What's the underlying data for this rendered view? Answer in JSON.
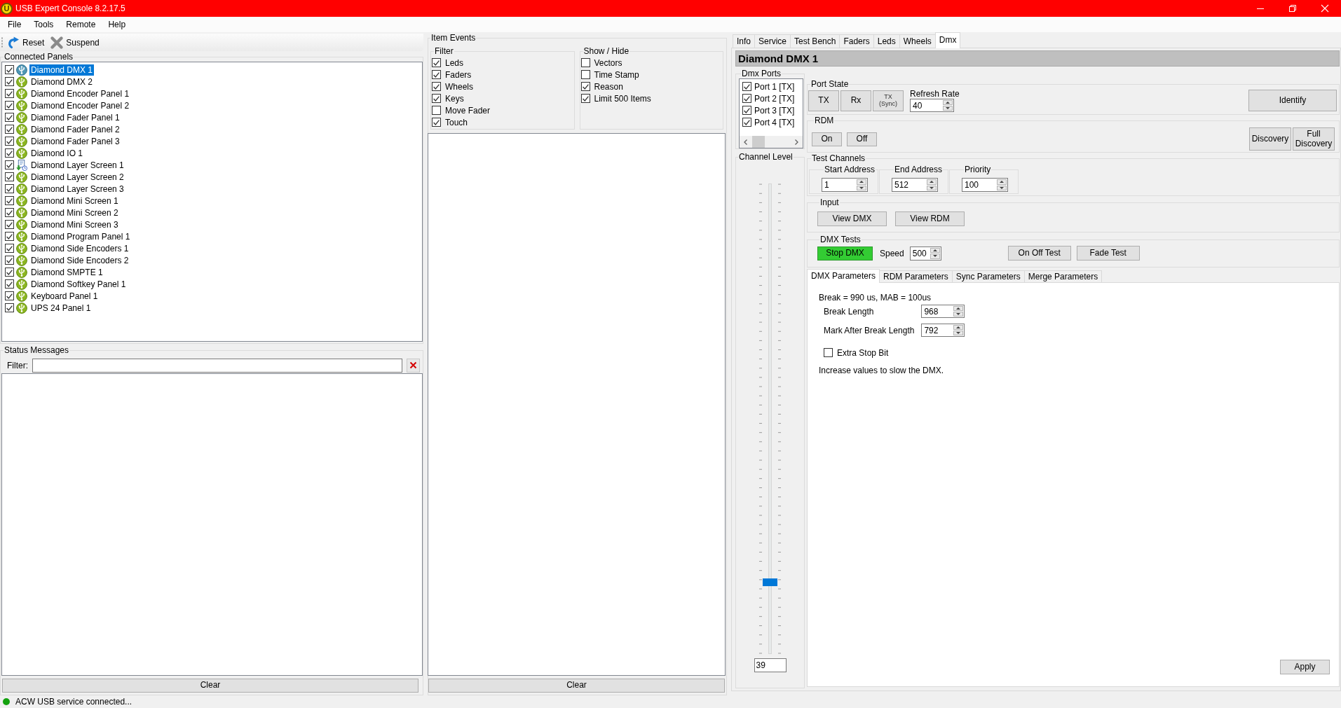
{
  "window": {
    "title": "USB Expert Console 8.2.17.5",
    "logo": "U"
  },
  "menu": [
    "File",
    "Tools",
    "Remote",
    "Help"
  ],
  "toolbar": [
    {
      "label": "Reset",
      "kind": "reset"
    },
    {
      "label": "Suspend",
      "kind": "suspend"
    }
  ],
  "connected_panels": {
    "title": "Connected Panels",
    "items": [
      {
        "label": "Diamond DMX 1",
        "kind": "usb",
        "checked": true,
        "selected": true
      },
      {
        "label": "Diamond DMX 2",
        "kind": "usb",
        "checked": true,
        "selected": false
      },
      {
        "label": "Diamond Encoder Panel 1",
        "kind": "usb",
        "checked": true,
        "selected": false
      },
      {
        "label": "Diamond Encoder Panel 2",
        "kind": "usb",
        "checked": true,
        "selected": false
      },
      {
        "label": "Diamond Fader Panel 1",
        "kind": "usb",
        "checked": true,
        "selected": false
      },
      {
        "label": "Diamond Fader Panel 2",
        "kind": "usb",
        "checked": true,
        "selected": false
      },
      {
        "label": "Diamond Fader Panel 3",
        "kind": "usb",
        "checked": true,
        "selected": false
      },
      {
        "label": "Diamond IO 1",
        "kind": "usb",
        "checked": true,
        "selected": false
      },
      {
        "label": "Diamond Layer Screen 1",
        "kind": "update",
        "checked": true,
        "selected": false
      },
      {
        "label": "Diamond Layer Screen 2",
        "kind": "usb",
        "checked": true,
        "selected": false
      },
      {
        "label": "Diamond Layer Screen 3",
        "kind": "usb",
        "checked": true,
        "selected": false
      },
      {
        "label": "Diamond Mini Screen 1",
        "kind": "usb",
        "checked": true,
        "selected": false
      },
      {
        "label": "Diamond Mini Screen 2",
        "kind": "usb",
        "checked": true,
        "selected": false
      },
      {
        "label": "Diamond Mini Screen 3",
        "kind": "usb",
        "checked": true,
        "selected": false
      },
      {
        "label": "Diamond Program Panel 1",
        "kind": "usb",
        "checked": true,
        "selected": false
      },
      {
        "label": "Diamond Side Encoders 1",
        "kind": "usb",
        "checked": true,
        "selected": false
      },
      {
        "label": "Diamond Side Encoders 2",
        "kind": "usb",
        "checked": true,
        "selected": false
      },
      {
        "label": "Diamond SMPTE 1",
        "kind": "usb",
        "checked": true,
        "selected": false
      },
      {
        "label": "Diamond Softkey Panel 1",
        "kind": "usb",
        "checked": true,
        "selected": false
      },
      {
        "label": "Keyboard Panel 1",
        "kind": "usb",
        "checked": true,
        "selected": false
      },
      {
        "label": "UPS 24 Panel 1",
        "kind": "usb",
        "checked": true,
        "selected": false
      }
    ]
  },
  "status_messages": {
    "title": "Status Messages",
    "filter_label": "Filter:",
    "clear_button": "Clear"
  },
  "item_events": {
    "title": "Item Events",
    "filter": {
      "title": "Filter",
      "items": [
        {
          "label": "Leds",
          "checked": true
        },
        {
          "label": "Faders",
          "checked": true
        },
        {
          "label": "Wheels",
          "checked": true
        },
        {
          "label": "Keys",
          "checked": true
        },
        {
          "label": "Move Fader",
          "checked": false
        },
        {
          "label": "Touch",
          "checked": true
        }
      ]
    },
    "show_hide": {
      "title": "Show / Hide",
      "items": [
        {
          "label": "Vectors",
          "checked": false
        },
        {
          "label": "Time Stamp",
          "checked": false
        },
        {
          "label": "Reason",
          "checked": true
        },
        {
          "label": "Limit 500 Items",
          "checked": true
        }
      ]
    },
    "clear_button": "Clear"
  },
  "tabs": [
    {
      "label": "Info",
      "selected": false
    },
    {
      "label": "Service",
      "selected": false
    },
    {
      "label": "Test Bench",
      "selected": false
    },
    {
      "label": "Faders",
      "selected": false
    },
    {
      "label": "Leds",
      "selected": false
    },
    {
      "label": "Wheels",
      "selected": false
    },
    {
      "label": "Dmx",
      "selected": true
    }
  ],
  "device": {
    "name": "Diamond DMX 1"
  },
  "dmx_ports": {
    "title": "Dmx Ports",
    "items": [
      {
        "label": "Port 1 [TX]",
        "checked": true
      },
      {
        "label": "Port 2 [TX]",
        "checked": true
      },
      {
        "label": "Port 3 [TX]",
        "checked": true
      },
      {
        "label": "Port 4 [TX]",
        "checked": true
      }
    ]
  },
  "channel_level": {
    "title": "Channel Level",
    "level": 0.153,
    "value": "39"
  },
  "port_state": {
    "title": "Port State",
    "buttons": [
      {
        "label": "TX"
      },
      {
        "label": "Rx"
      },
      {
        "label": "TX",
        "sublabel": "(Sync)"
      }
    ],
    "refresh_rate": {
      "label": "Refresh Rate",
      "value": "40"
    },
    "identify_button": "Identify"
  },
  "rdm": {
    "title": "RDM",
    "buttons": [
      "On",
      "Off"
    ],
    "discovery_buttons": [
      "Discovery",
      "Full Discovery"
    ]
  },
  "test_channels": {
    "title": "Test Channels",
    "fields": [
      {
        "label": "Start Address",
        "value": "1"
      },
      {
        "label": "End Address",
        "value": "512"
      },
      {
        "label": "Priority",
        "value": "100"
      }
    ]
  },
  "input": {
    "title": "Input",
    "buttons": [
      "View DMX",
      "View RDM"
    ]
  },
  "dmx_tests": {
    "title": "DMX Tests",
    "stop_button": {
      "label": "Stop DMX",
      "running": true
    },
    "speed": {
      "label": "Speed",
      "value": "500"
    },
    "buttons": [
      "On Off Test",
      "Fade Test"
    ]
  },
  "parameter_tabs": [
    {
      "label": "DMX Parameters",
      "selected": true
    },
    {
      "label": "RDM Parameters",
      "selected": false
    },
    {
      "label": "Sync Parameters",
      "selected": false
    },
    {
      "label": "Merge Parameters",
      "selected": false
    }
  ],
  "dmx_parameters": {
    "summary": "Break = 990 us, MAB = 100us",
    "fields": [
      {
        "label": "Break Length",
        "value": "968"
      },
      {
        "label": "Mark After Break Length",
        "value": "792"
      }
    ],
    "extra_stop_bit": {
      "label": "Extra Stop Bit",
      "checked": false
    },
    "note": "Increase values to slow the DMX.",
    "apply_button": "Apply"
  },
  "status_bar": {
    "text": "ACW USB service connected...",
    "connected": true
  }
}
